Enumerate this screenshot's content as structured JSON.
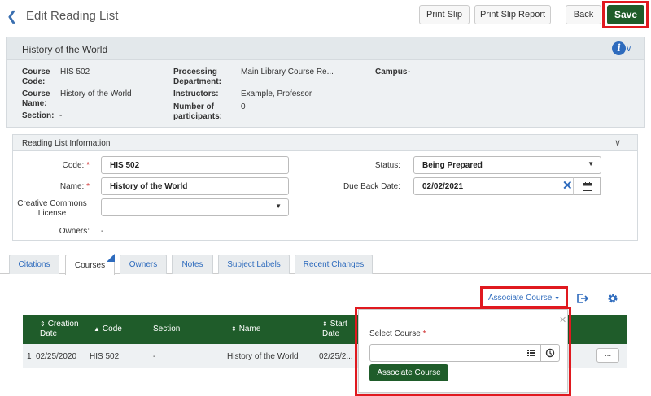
{
  "header": {
    "title": "Edit Reading List",
    "print_slip_label": "Print Slip",
    "print_slip_report_label": "Print Slip Report",
    "back_label": "Back",
    "save_label": "Save"
  },
  "course": {
    "title": "History of the World",
    "fields": {
      "course_code_label": "Course Code:",
      "course_code_value": "HIS 502",
      "course_name_label": "Course Name:",
      "course_name_value": "History of the World",
      "section_label": "Section:",
      "section_value": "-",
      "processing_department_label": "Processing Department:",
      "processing_department_value": "Main Library Course Re...",
      "instructors_label": "Instructors:",
      "instructors_value": "Example, Professor",
      "participants_label": "Number of participants:",
      "participants_value": "0",
      "campus_label": "Campus",
      "campus_value": "-"
    }
  },
  "reading_list": {
    "section_title": "Reading List Information",
    "code_label": "Code:",
    "code_value": "HIS 502",
    "name_label": "Name:",
    "name_value": "History of the World",
    "cc_license_label": "Creative Commons License",
    "cc_license_value": "",
    "owners_label": "Owners:",
    "owners_value": "-",
    "status_label": "Status:",
    "status_value": "Being Prepared",
    "due_back_label": "Due Back Date:",
    "due_back_value": "02/02/2021"
  },
  "tabs": [
    {
      "label": "Citations"
    },
    {
      "label": "Courses"
    },
    {
      "label": "Owners"
    },
    {
      "label": "Notes"
    },
    {
      "label": "Subject Labels"
    },
    {
      "label": "Recent Changes"
    }
  ],
  "active_tab": "Courses",
  "courses_toolbar": {
    "associate_course_label": "Associate Course"
  },
  "courses_table": {
    "columns": [
      "Creation Date",
      "Code",
      "Section",
      "Name",
      "Start Date"
    ],
    "rows": [
      {
        "index": "1",
        "creation_date": "02/25/2020",
        "code": "HIS 502",
        "section": "-",
        "name": "History of the World",
        "start_date": "02/25/2..."
      }
    ],
    "row_actions_label": "..."
  },
  "associate_popover": {
    "select_course_label": "Select Course",
    "select_course_value": "",
    "submit_label": "Associate Course"
  },
  "colors": {
    "primary_green": "#1f5c2a",
    "link_blue": "#2e6bbd",
    "highlight_red": "#e0191f"
  }
}
